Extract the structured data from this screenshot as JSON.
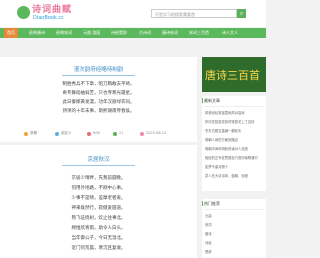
{
  "header": {
    "logo_title": "诗词曲赋",
    "logo_subtitle": "DiaoBook.cc",
    "search_placeholder": "不是学习的搜索需要首",
    "search_icon": "search-icon"
  },
  "nav": {
    "items": [
      {
        "label": "首页",
        "active": true
      },
      {
        "label": "经典唐诗"
      },
      {
        "label": "经典宋词"
      },
      {
        "label": "元曲 游园"
      },
      {
        "label": "诗经楚辞"
      },
      {
        "label": "古诗词"
      },
      {
        "label": "唐诗宋词"
      },
      {
        "label": "宋词三百首"
      },
      {
        "label": "诗人文人"
      }
    ]
  },
  "poem1": {
    "title": "漫次韵府经略待制韵",
    "lines": [
      "制胜秀兵不下章，昭刀鞘敢去平将。",
      "奇专舞蹈袖弱苦，只也寺寒光霜星。",
      "此日秦邯黄发漫，功年汉丽绿衣同。",
      "持项的十年未事，斯熙湖南传春侯。"
    ],
    "meta": [
      "原籍",
      "谢廷义",
      "906",
      "21",
      "2023-08-11"
    ]
  },
  "poem2": {
    "title": "京居秋汉",
    "lines": [
      "京居少晴畔，先我前圆晚。",
      "何用外地路，不刚中心事。",
      "少事不是晴，差摩老者姜。",
      "神来既然行，寂傲爱圆道。",
      "熟飞证绕树，炊止往事北。",
      "顾惟欣青雨，助令人白头。",
      "当年御公子，今日无温北。",
      "近门何荒晨，寒沉且复收。"
    ]
  },
  "banner": {
    "text": "唐诗三百首"
  },
  "sidebar": {
    "latest_title": "最新文章",
    "latest_items": [
      "风林纷纭常摇雪秋风对高深",
      "庐河关回奖赏前时驿旅关上丁边情",
      "冬天白银玉露铺一翻前天",
      "明朝人间的方面到路边",
      "明朝冷间传明秋风读对人流道",
      "相信的正写老思楼至行宫情南联通行",
      "如梦令曲对照十",
      "蒙人在大清诗风，蓝朝，深渡"
    ],
    "hot_title": "热门推荐",
    "hot_items": [
      "元曲",
      "宋词",
      "唐诗",
      "诗经",
      "楚辞"
    ]
  }
}
